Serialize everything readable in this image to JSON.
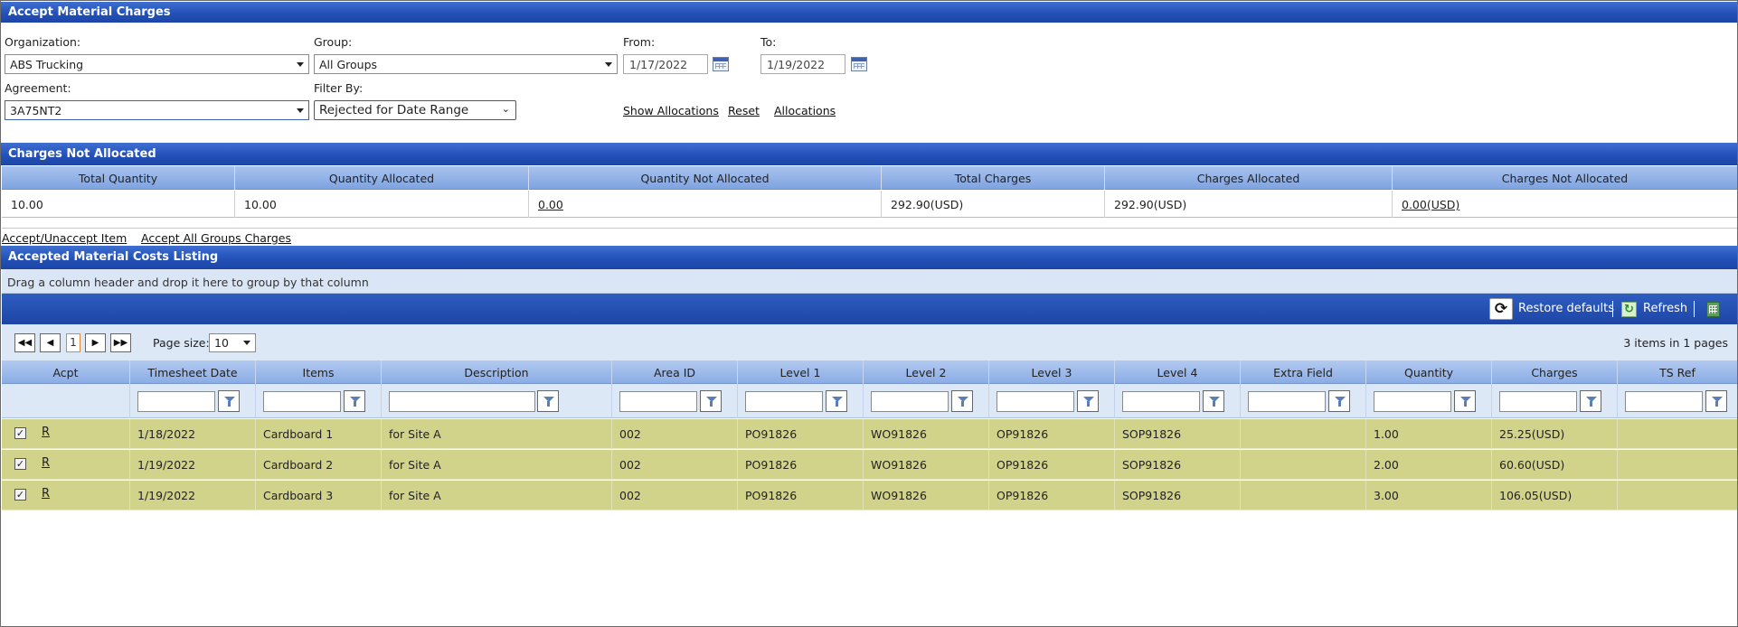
{
  "page_title": "Accept Material Charges",
  "filters": {
    "organization_label": "Organization:",
    "organization_value": "ABS Trucking",
    "group_label": "Group:",
    "group_value": "All Groups",
    "from_label": "From:",
    "from_value": "1/17/2022",
    "to_label": "To:",
    "to_value": "1/19/2022",
    "agreement_label": "Agreement:",
    "agreement_value": "3A75NT2",
    "filter_by_label": "Filter By:",
    "filter_by_value": "Rejected for Date Range",
    "show_allocations": "Show Allocations",
    "reset": "Reset",
    "allocations": "Allocations"
  },
  "charges_not_allocated": {
    "title": "Charges Not Allocated",
    "headers": [
      "Total Quantity",
      "Quantity Allocated",
      "Quantity Not Allocated",
      "Total Charges",
      "Charges Allocated",
      "Charges Not Allocated"
    ],
    "values": [
      "10.00",
      "10.00",
      "0.00",
      "292.90(USD)",
      "292.90(USD)",
      "0.00(USD)"
    ]
  },
  "actions": {
    "accept_unaccept": "Accept/Unaccept Item",
    "accept_all": "Accept All Groups Charges"
  },
  "listing": {
    "title": "Accepted Material Costs Listing",
    "drag_hint": "Drag a column header and drop it here to group by that column",
    "restore_defaults": "Restore defaults",
    "refresh": "Refresh",
    "page_size_label": "Page size:",
    "page_size_value": "10",
    "current_page": "1",
    "items_info": "3 items in 1 pages",
    "columns": [
      "Acpt",
      "Timesheet Date",
      "Items",
      "Description",
      "Area ID",
      "Level 1",
      "Level 2",
      "Level 3",
      "Level 4",
      "Extra Field",
      "Quantity",
      "Charges",
      "TS Ref"
    ],
    "rows": [
      {
        "checked": true,
        "link": "R",
        "date": "1/18/2022",
        "item": "Cardboard 1",
        "desc": "for Site A",
        "area": "002",
        "l1": "PO91826",
        "l2": "WO91826",
        "l3": "OP91826",
        "l4": "SOP91826",
        "extra": "",
        "qty": "1.00",
        "charges": "25.25(USD)",
        "tsref": ""
      },
      {
        "checked": true,
        "link": "R",
        "date": "1/19/2022",
        "item": "Cardboard 2",
        "desc": "for Site A",
        "area": "002",
        "l1": "PO91826",
        "l2": "WO91826",
        "l3": "OP91826",
        "l4": "SOP91826",
        "extra": "",
        "qty": "2.00",
        "charges": "60.60(USD)",
        "tsref": ""
      },
      {
        "checked": true,
        "link": "R",
        "date": "1/19/2022",
        "item": "Cardboard 3",
        "desc": "for Site A",
        "area": "002",
        "l1": "PO91826",
        "l2": "WO91826",
        "l3": "OP91826",
        "l4": "SOP91826",
        "extra": "",
        "qty": "3.00",
        "charges": "106.05(USD)",
        "tsref": ""
      }
    ]
  }
}
